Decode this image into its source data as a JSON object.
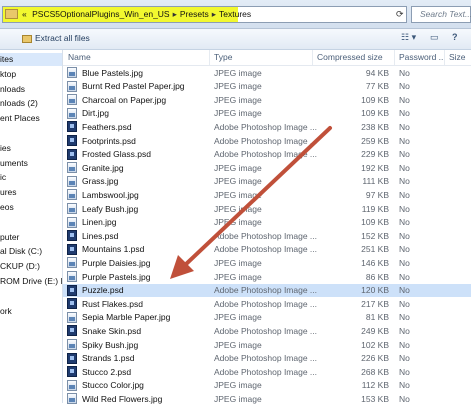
{
  "address": {
    "crumbs": [
      "PSCS5OptionalPlugins_Win_en_US",
      "Presets",
      "Textures"
    ],
    "leading_chevron": "«",
    "refresh_glyph": "⟳",
    "search_placeholder": "Search Text..."
  },
  "toolbar": {
    "extract_label": "Extract all files",
    "view_glyph": "☷ ▾",
    "pane_glyph": "▭",
    "help_glyph": "?"
  },
  "nav": {
    "items": [
      "ites",
      "ktop",
      "nloads",
      "nloads (2)",
      "ent Places",
      "",
      "ies",
      "uments",
      "ic",
      "ures",
      "eos",
      "",
      "puter",
      "al Disk (C:)",
      "CKUP (D:)",
      "ROM Drive (E:) I",
      "",
      "ork"
    ],
    "selected_index": 0
  },
  "columns": {
    "name": "Name",
    "type": "Type",
    "compressed": "Compressed size",
    "password": "Password ...",
    "size": "Size"
  },
  "files": [
    {
      "name": "Blue Pastels.jpg",
      "type": "JPEG image",
      "size": "94 KB",
      "pwd": "No",
      "kind": "jpg"
    },
    {
      "name": "Burnt Red Pastel Paper.jpg",
      "type": "JPEG image",
      "size": "77 KB",
      "pwd": "No",
      "kind": "jpg"
    },
    {
      "name": "Charcoal on Paper.jpg",
      "type": "JPEG image",
      "size": "109 KB",
      "pwd": "No",
      "kind": "jpg"
    },
    {
      "name": "Dirt.jpg",
      "type": "JPEG image",
      "size": "109 KB",
      "pwd": "No",
      "kind": "jpg"
    },
    {
      "name": "Feathers.psd",
      "type": "Adobe Photoshop Image ...",
      "size": "238 KB",
      "pwd": "No",
      "kind": "psd"
    },
    {
      "name": "Footprints.psd",
      "type": "Adobe Photoshop Image ...",
      "size": "259 KB",
      "pwd": "No",
      "kind": "psd"
    },
    {
      "name": "Frosted Glass.psd",
      "type": "Adobe Photoshop Image ...",
      "size": "229 KB",
      "pwd": "No",
      "kind": "psd"
    },
    {
      "name": "Granite.jpg",
      "type": "JPEG image",
      "size": "192 KB",
      "pwd": "No",
      "kind": "jpg"
    },
    {
      "name": "Grass.jpg",
      "type": "JPEG image",
      "size": "111 KB",
      "pwd": "No",
      "kind": "jpg"
    },
    {
      "name": "Lambswool.jpg",
      "type": "JPEG image",
      "size": "97 KB",
      "pwd": "No",
      "kind": "jpg"
    },
    {
      "name": "Leafy Bush.jpg",
      "type": "JPEG image",
      "size": "119 KB",
      "pwd": "No",
      "kind": "jpg"
    },
    {
      "name": "Linen.jpg",
      "type": "JPEG image",
      "size": "109 KB",
      "pwd": "No",
      "kind": "jpg"
    },
    {
      "name": "Lines.psd",
      "type": "Adobe Photoshop Image ...",
      "size": "152 KB",
      "pwd": "No",
      "kind": "psd"
    },
    {
      "name": "Mountains 1.psd",
      "type": "Adobe Photoshop Image ...",
      "size": "251 KB",
      "pwd": "No",
      "kind": "psd"
    },
    {
      "name": "Purple Daisies.jpg",
      "type": "JPEG image",
      "size": "146 KB",
      "pwd": "No",
      "kind": "jpg"
    },
    {
      "name": "Purple Pastels.jpg",
      "type": "JPEG image",
      "size": "86 KB",
      "pwd": "No",
      "kind": "jpg"
    },
    {
      "name": "Puzzle.psd",
      "type": "Adobe Photoshop Image ...",
      "size": "120 KB",
      "pwd": "No",
      "kind": "psd"
    },
    {
      "name": "Rust Flakes.psd",
      "type": "Adobe Photoshop Image ...",
      "size": "217 KB",
      "pwd": "No",
      "kind": "psd"
    },
    {
      "name": "Sepia Marble Paper.jpg",
      "type": "JPEG image",
      "size": "81 KB",
      "pwd": "No",
      "kind": "jpg"
    },
    {
      "name": "Snake Skin.psd",
      "type": "Adobe Photoshop Image ...",
      "size": "249 KB",
      "pwd": "No",
      "kind": "psd"
    },
    {
      "name": "Spiky Bush.jpg",
      "type": "JPEG image",
      "size": "102 KB",
      "pwd": "No",
      "kind": "jpg"
    },
    {
      "name": "Strands 1.psd",
      "type": "Adobe Photoshop Image ...",
      "size": "226 KB",
      "pwd": "No",
      "kind": "psd"
    },
    {
      "name": "Stucco 2.psd",
      "type": "Adobe Photoshop Image ...",
      "size": "268 KB",
      "pwd": "No",
      "kind": "psd"
    },
    {
      "name": "Stucco Color.jpg",
      "type": "JPEG image",
      "size": "112 KB",
      "pwd": "No",
      "kind": "jpg"
    },
    {
      "name": "Wild Red Flowers.jpg",
      "type": "JPEG image",
      "size": "153 KB",
      "pwd": "No",
      "kind": "jpg"
    }
  ],
  "selected_file_index": 16,
  "colors": {
    "highlight": "#f2f82f",
    "selection": "#cde1f9",
    "annotation_arrow": "#c0503a"
  }
}
